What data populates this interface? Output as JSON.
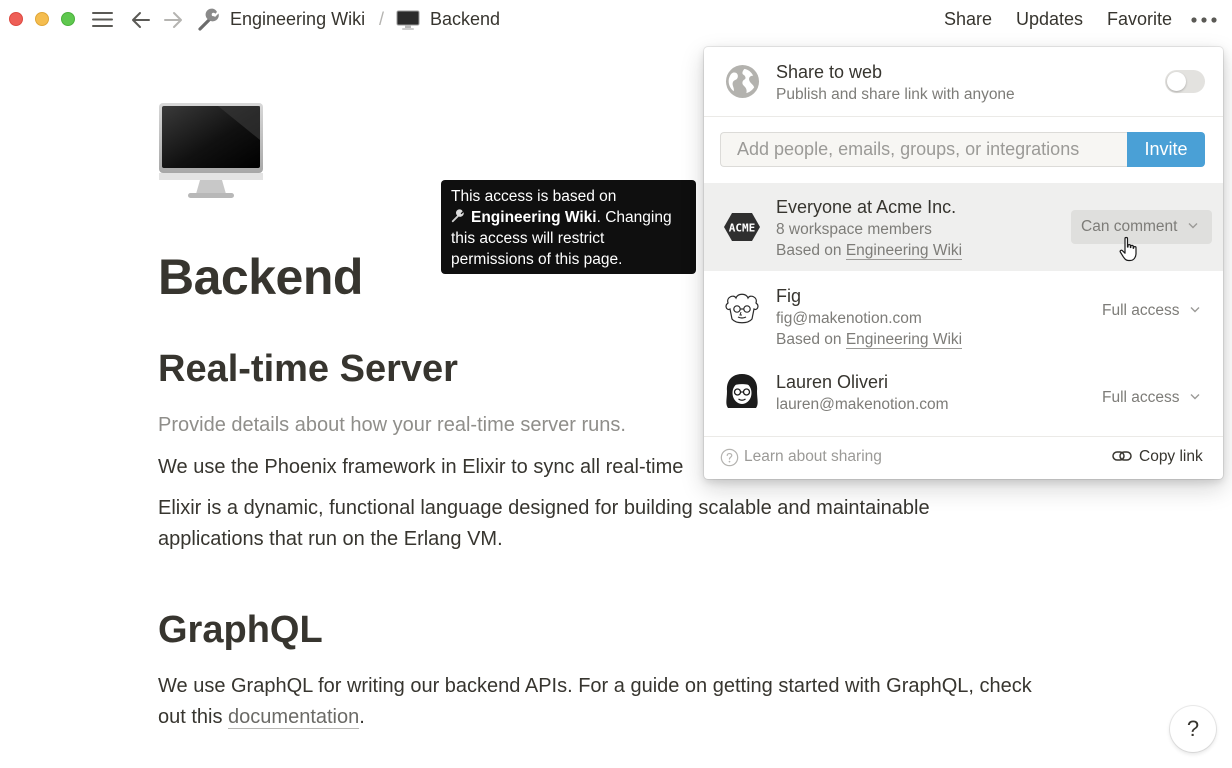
{
  "topbar": {
    "breadcrumb": [
      {
        "icon": "wrench-icon",
        "label": "Engineering Wiki"
      },
      {
        "icon": "desktop-computer-icon",
        "label": "Backend"
      }
    ],
    "separator": "/",
    "actions": {
      "share": "Share",
      "updates": "Updates",
      "favorite": "Favorite"
    }
  },
  "page": {
    "icon": "desktop-computer-icon",
    "title": "Backend",
    "sections": {
      "realtime": {
        "heading": "Real-time Server",
        "placeholder_text": "Provide details about how your real-time server runs.",
        "phoenix_text": "We use the Phoenix framework in Elixir to sync all real-time",
        "elixir_text": "Elixir is a dynamic, functional language designed for building scalable and maintainable applications that run on the Erlang VM."
      },
      "graphql": {
        "heading": "GraphQL",
        "text_before": "We use GraphQL for writing our backend APIs. For a guide on getting started with GraphQL, check out this ",
        "link": "documentation",
        "text_after": "."
      }
    }
  },
  "tooltip": {
    "line_1": "This access is based on",
    "bold_page": "Engineering Wiki",
    "rest": ". Changing this access will restrict permissions of this page."
  },
  "share_popup": {
    "share_to_web": {
      "title": "Share to web",
      "subtitle": "Publish and share link with anyone",
      "enabled": false
    },
    "invite": {
      "placeholder": "Add people, emails, groups, or integrations",
      "button": "Invite"
    },
    "members": [
      {
        "name": "Everyone at Acme Inc.",
        "detail": "8 workspace members",
        "based_on_label": "Based on ",
        "based_on_page": "Engineering Wiki",
        "permission": "Can comment",
        "avatar": "acme-logo-icon"
      },
      {
        "name": "Fig",
        "detail": "fig@makenotion.com",
        "based_on_label": "Based on ",
        "based_on_page": "Engineering Wiki",
        "permission": "Full access",
        "avatar": "fig-avatar"
      },
      {
        "name": "Lauren Oliveri",
        "detail": "lauren@makenotion.com",
        "permission": "Full access",
        "avatar": "lauren-avatar"
      }
    ],
    "footer": {
      "learn": "Learn about sharing",
      "copy_link": "Copy link"
    }
  },
  "help_button": {
    "label": "?"
  },
  "colors": {
    "invite_button": "#4aa0d6",
    "tooltip_bg": "#0f0f0f",
    "hover_row": "#efefee",
    "text": "#37352f"
  }
}
